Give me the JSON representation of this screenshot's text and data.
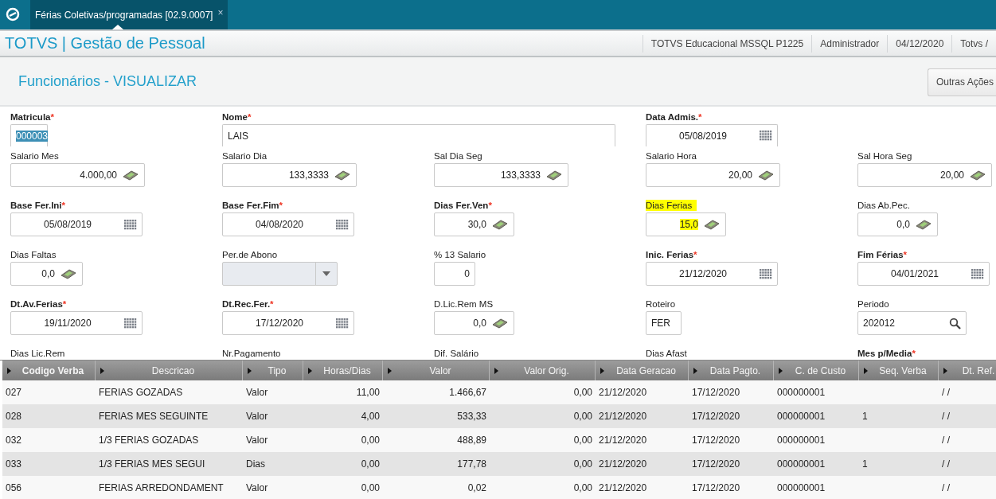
{
  "top_bar": {
    "tab": {
      "label": "Férias Coletivas/programadas [02.9.0007]",
      "close": "×",
      "selected": true
    }
  },
  "header": {
    "title": "TOTVS | Gestão de Pessoal",
    "info": [
      "TOTVS Educacional MSSQL P1225",
      "Administrador",
      "04/12/2020",
      "Totvs /"
    ]
  },
  "page": {
    "title": "Funcionários - VISUALIZAR",
    "action": "Outras Ações"
  },
  "form_rows": [
    [
      {
        "label": "Matricula",
        "mark": "*",
        "kind": "text",
        "value": "000003",
        "text_selected": true,
        "highlighted": false,
        "disabled": false
      },
      {
        "label": "Nome",
        "mark": "*",
        "kind": "text",
        "value": "LAIS",
        "text_selected": false,
        "highlighted": false,
        "disabled": false
      },
      null,
      {
        "label": "Data Admis.",
        "mark": "*",
        "kind": "date",
        "value": "05/08/2019",
        "highlighted": false,
        "disabled": false
      },
      null
    ],
    [
      {
        "label": "Salario Mes",
        "kind": "money",
        "value": "4.000,00",
        "highlighted": false,
        "disabled": false
      },
      {
        "label": "Salario Dia",
        "kind": "money",
        "value": "133,3333",
        "highlighted": false,
        "disabled": false
      },
      {
        "label": "Sal Dia Seg",
        "kind": "money",
        "value": "133,3333",
        "highlighted": false,
        "disabled": false
      },
      {
        "label": "Salario Hora",
        "kind": "money",
        "value": "20,00",
        "highlighted": false,
        "disabled": false
      },
      {
        "label": "Sal Hora Seg",
        "kind": "money",
        "value": "20,00",
        "highlighted": false,
        "disabled": false
      }
    ],
    [
      {
        "label": "Base Fer.Ini",
        "mark": "*",
        "kind": "date",
        "value": "05/08/2019",
        "highlighted": false,
        "disabled": false
      },
      {
        "label": "Base Fer.Fim",
        "mark": "*",
        "kind": "date",
        "value": "04/08/2020",
        "highlighted": false,
        "disabled": false
      },
      {
        "label": "Dias Fer.Ven",
        "mark": "*",
        "kind": "money",
        "value": "30,0",
        "highlighted": false,
        "disabled": false
      },
      {
        "label": "Dias Ferias",
        "kind": "money",
        "value": "15,0",
        "highlighted": true,
        "disabled": false
      },
      {
        "label": "Dias Ab.Pec.",
        "kind": "money",
        "value": "0,0",
        "highlighted": false,
        "disabled": false
      }
    ],
    [
      {
        "label": "Dias Faltas",
        "kind": "money",
        "value": "0,0",
        "highlighted": false,
        "disabled": false
      },
      {
        "label": "Per.de Abono",
        "kind": "combo",
        "highlighted": false,
        "disabled": true
      },
      {
        "label": "% 13 Salario",
        "kind": "plain",
        "value": "0",
        "highlighted": false,
        "disabled": false
      },
      {
        "label": "Inic. Ferias",
        "mark": "*",
        "kind": "date",
        "value": "21/12/2020",
        "highlighted": false,
        "disabled": false
      },
      {
        "label": "Fim Férias",
        "mark": "*",
        "kind": "date",
        "value": "04/01/2021",
        "highlighted": false,
        "disabled": false
      }
    ],
    [
      {
        "label": "Dt.Av.Ferias",
        "mark": "*",
        "kind": "date",
        "value": "19/11/2020",
        "highlighted": false,
        "disabled": false
      },
      {
        "label": "Dt.Rec.Fer.",
        "mark": "*",
        "kind": "date",
        "value": "17/12/2020",
        "highlighted": false,
        "disabled": false
      },
      {
        "label": "D.Lic.Rem MS",
        "kind": "money",
        "value": "0,0",
        "highlighted": false,
        "disabled": false
      },
      {
        "label": "Roteiro",
        "kind": "plain",
        "value": "FER",
        "highlighted": false,
        "disabled": false
      },
      {
        "label": "Periodo",
        "kind": "search",
        "value": "202012",
        "highlighted": false,
        "disabled": false
      }
    ],
    [
      {
        "label": "Dias Lic.Rem",
        "kind": "label"
      },
      {
        "label": "Nr.Pagamento",
        "kind": "label"
      },
      {
        "label": "Dif. Salário",
        "kind": "label"
      },
      {
        "label": "Dias Afast",
        "kind": "label"
      },
      {
        "label": "Mes p/Media",
        "mark": "*",
        "kind": "label"
      }
    ]
  ],
  "table": {
    "columns": [
      "Codigo Verba",
      "Descricao",
      "Tipo",
      "Horas/Dias",
      "Valor",
      "Valor Orig.",
      "Data Geracao",
      "Data Pagto.",
      "C. de Custo",
      "Seq. Verba",
      "Dt. Ref."
    ],
    "rows": [
      [
        "027",
        "FERIAS GOZADAS",
        "Valor",
        "11,00",
        "1.466,67",
        "0,00",
        "21/12/2020",
        "17/12/2020",
        "000000001",
        null,
        "/  /"
      ],
      [
        "028",
        "FERIAS MES SEGUINTE",
        "Valor",
        "4,00",
        "533,33",
        "0,00",
        "21/12/2020",
        "17/12/2020",
        "000000001",
        "1",
        "/  /"
      ],
      [
        "032",
        "1/3 FERIAS GOZADAS",
        "Valor",
        "0,00",
        "488,89",
        "0,00",
        "21/12/2020",
        "17/12/2020",
        "000000001",
        null,
        "/  /"
      ],
      [
        "033",
        "1/3 FERIAS MES SEGUI",
        "Dias",
        "0,00",
        "177,78",
        "0,00",
        "21/12/2020",
        "17/12/2020",
        "000000001",
        "1",
        "/  /"
      ],
      [
        "056",
        "FERIAS ARREDONDAMENT",
        "Valor",
        "0,00",
        "0,02",
        "0,00",
        "21/12/2020",
        "17/12/2020",
        "000000001",
        null,
        "/  /"
      ]
    ]
  }
}
